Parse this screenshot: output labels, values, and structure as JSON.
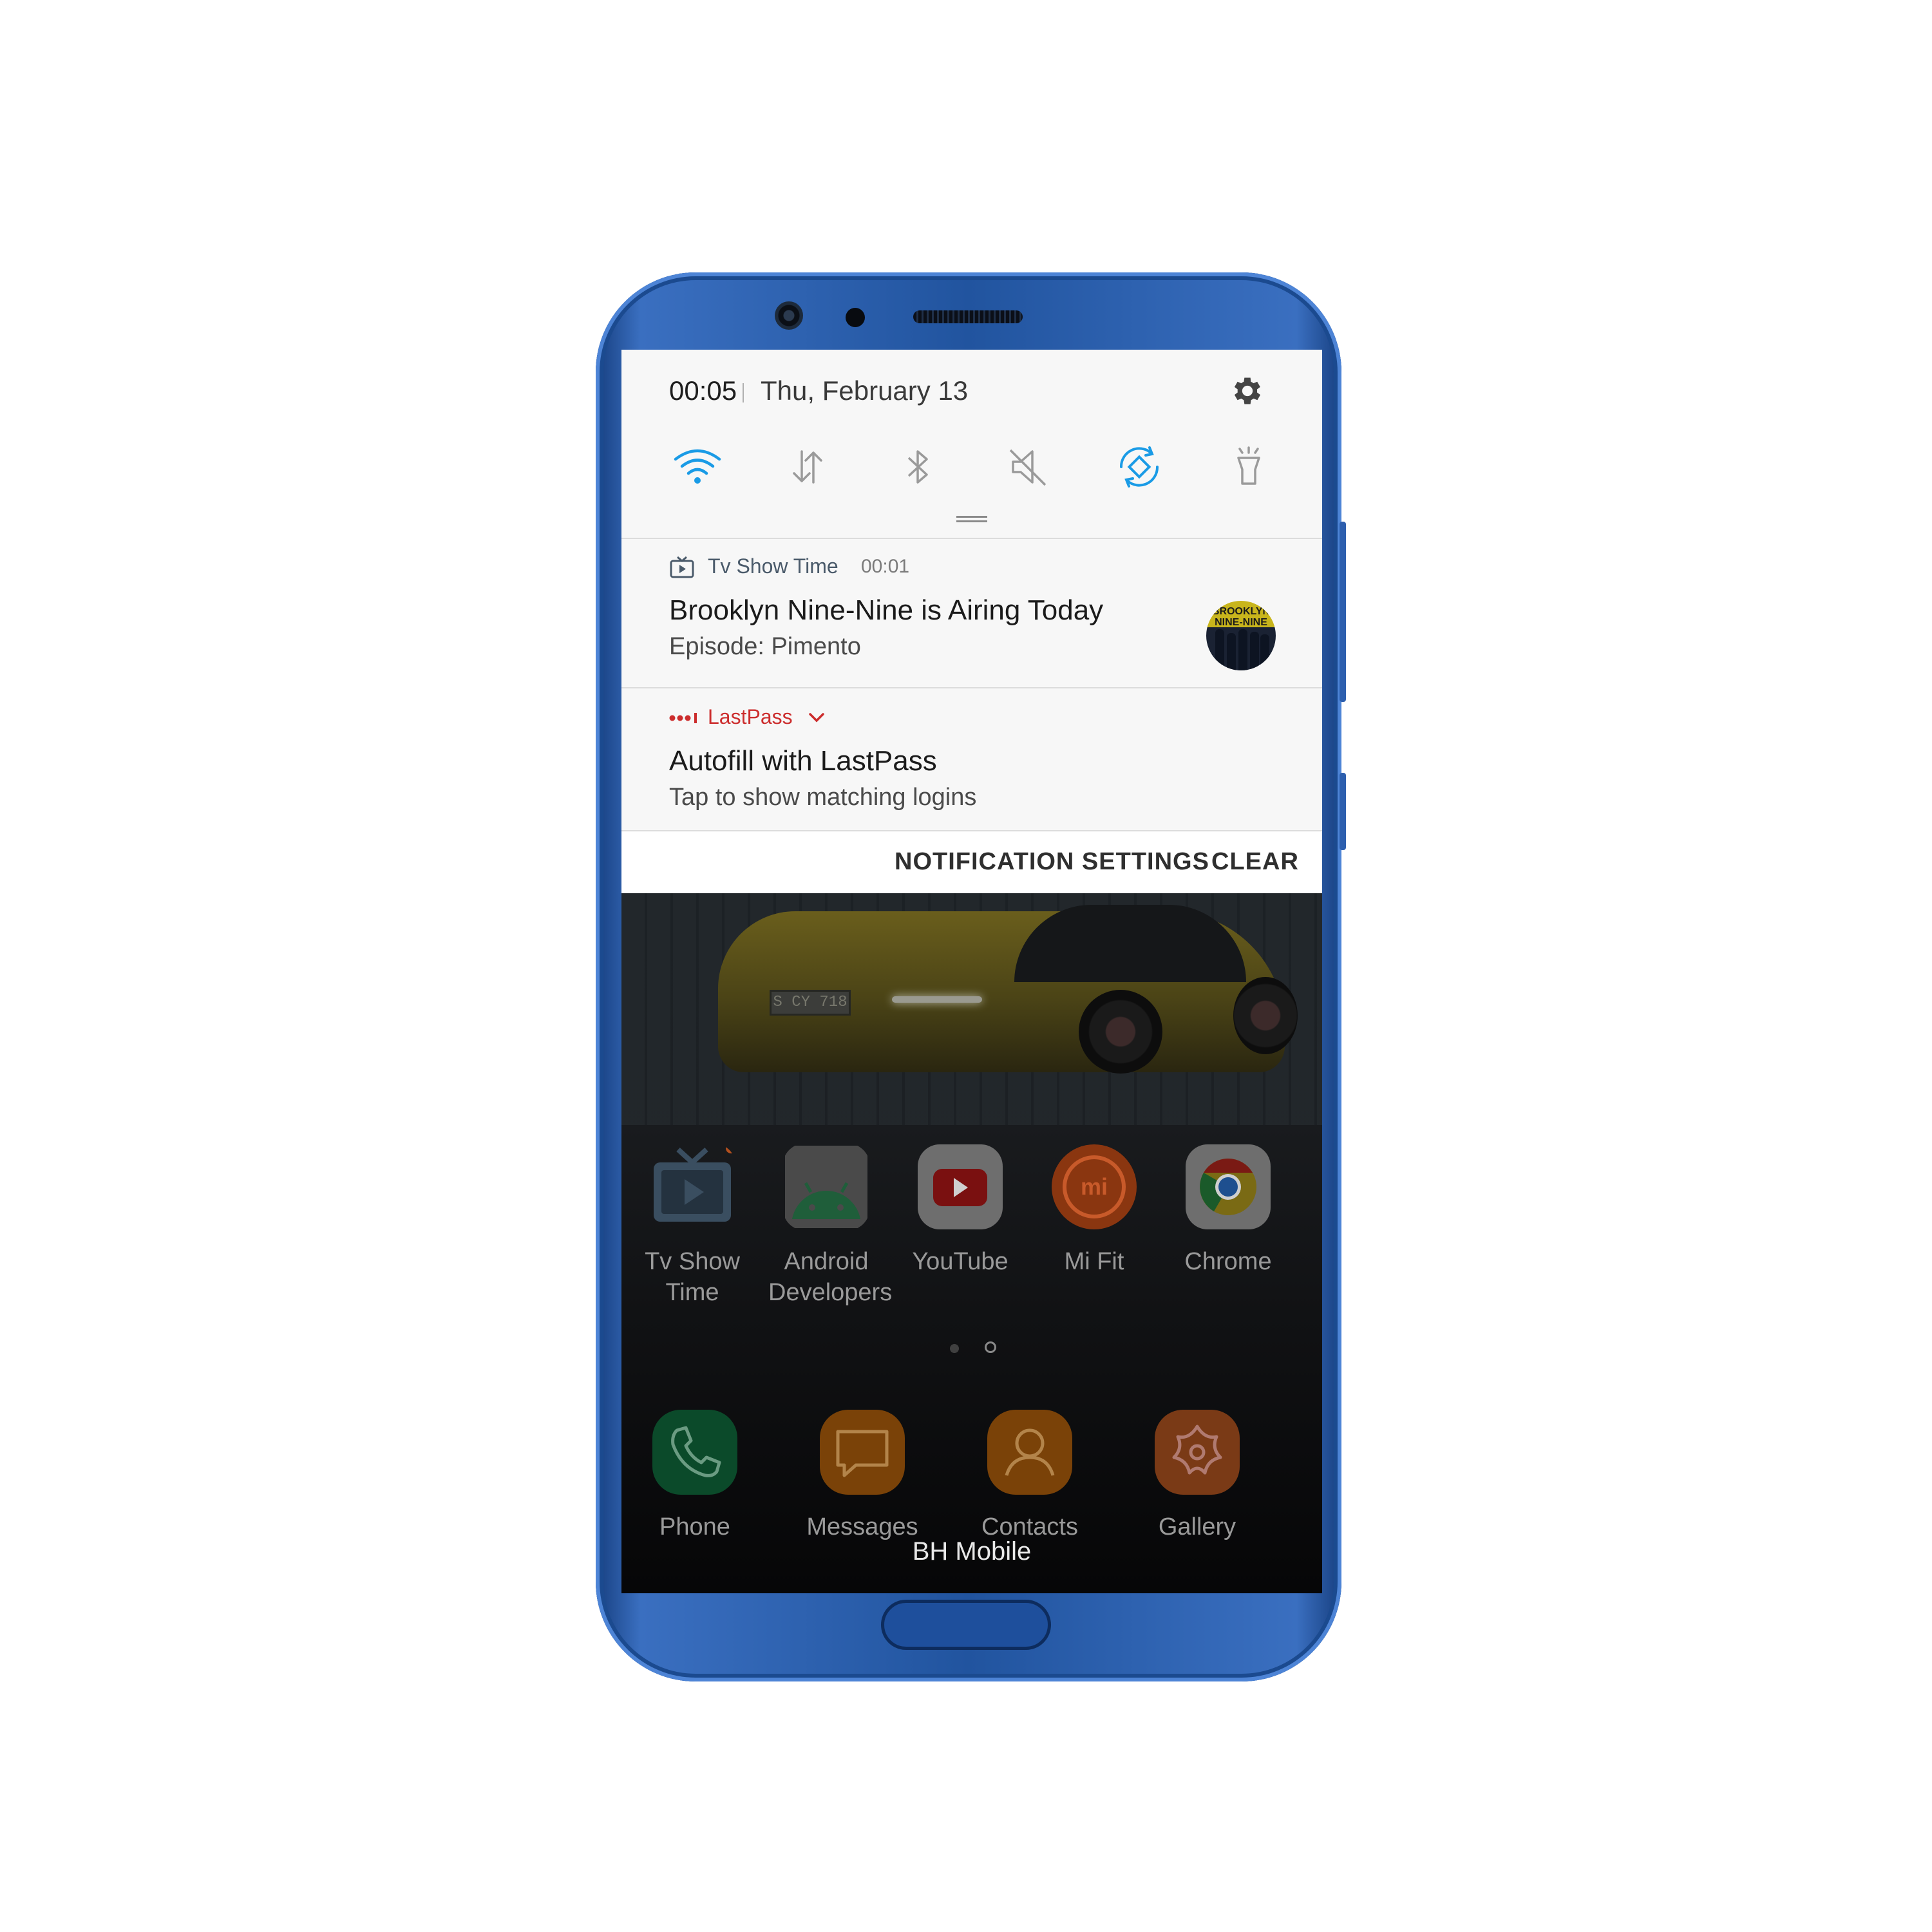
{
  "status": {
    "time": "00:05",
    "date": "Thu, February 13"
  },
  "quick_settings": [
    {
      "name": "wifi",
      "active": true
    },
    {
      "name": "mobile-data",
      "active": false
    },
    {
      "name": "bluetooth",
      "active": false
    },
    {
      "name": "mute",
      "active": false
    },
    {
      "name": "auto-rotate",
      "active": true
    },
    {
      "name": "flashlight",
      "active": false
    }
  ],
  "notifications": [
    {
      "app": "Tv Show Time",
      "time": "00:01",
      "title": "Brooklyn Nine-Nine is Airing Today",
      "subtitle": "Episode: Pimento",
      "thumbnail_text": "BROOKLYN NINE-NINE"
    },
    {
      "app": "LastPass",
      "title": "Autofill with LastPass",
      "subtitle": "Tap to show matching logins"
    }
  ],
  "actions": {
    "notification_settings": "NOTIFICATION SETTINGS",
    "clear": "CLEAR"
  },
  "home": {
    "plate": "S CY 718",
    "apps": [
      {
        "label": "Tv Show Time",
        "icon": "tv-show-time-icon",
        "badge": true
      },
      {
        "label": "Android Developers",
        "icon": "android-icon",
        "badge": false
      },
      {
        "label": "YouTube",
        "icon": "youtube-icon",
        "badge": false
      },
      {
        "label": "Mi Fit",
        "icon": "mi-fit-icon",
        "badge": false
      },
      {
        "label": "Chrome",
        "icon": "chrome-icon",
        "badge": false
      }
    ],
    "dock": [
      {
        "label": "Phone",
        "icon": "phone-icon"
      },
      {
        "label": "Messages",
        "icon": "messages-icon"
      },
      {
        "label": "Contacts",
        "icon": "contacts-icon"
      },
      {
        "label": "Gallery",
        "icon": "gallery-icon"
      }
    ],
    "page_indicator": {
      "pages": 2,
      "current": 2
    },
    "carrier": "BH Mobile"
  },
  "colors": {
    "accent": "#1a9be6",
    "lastpass": "#cc2d2d",
    "phone_body": "#21549f"
  }
}
